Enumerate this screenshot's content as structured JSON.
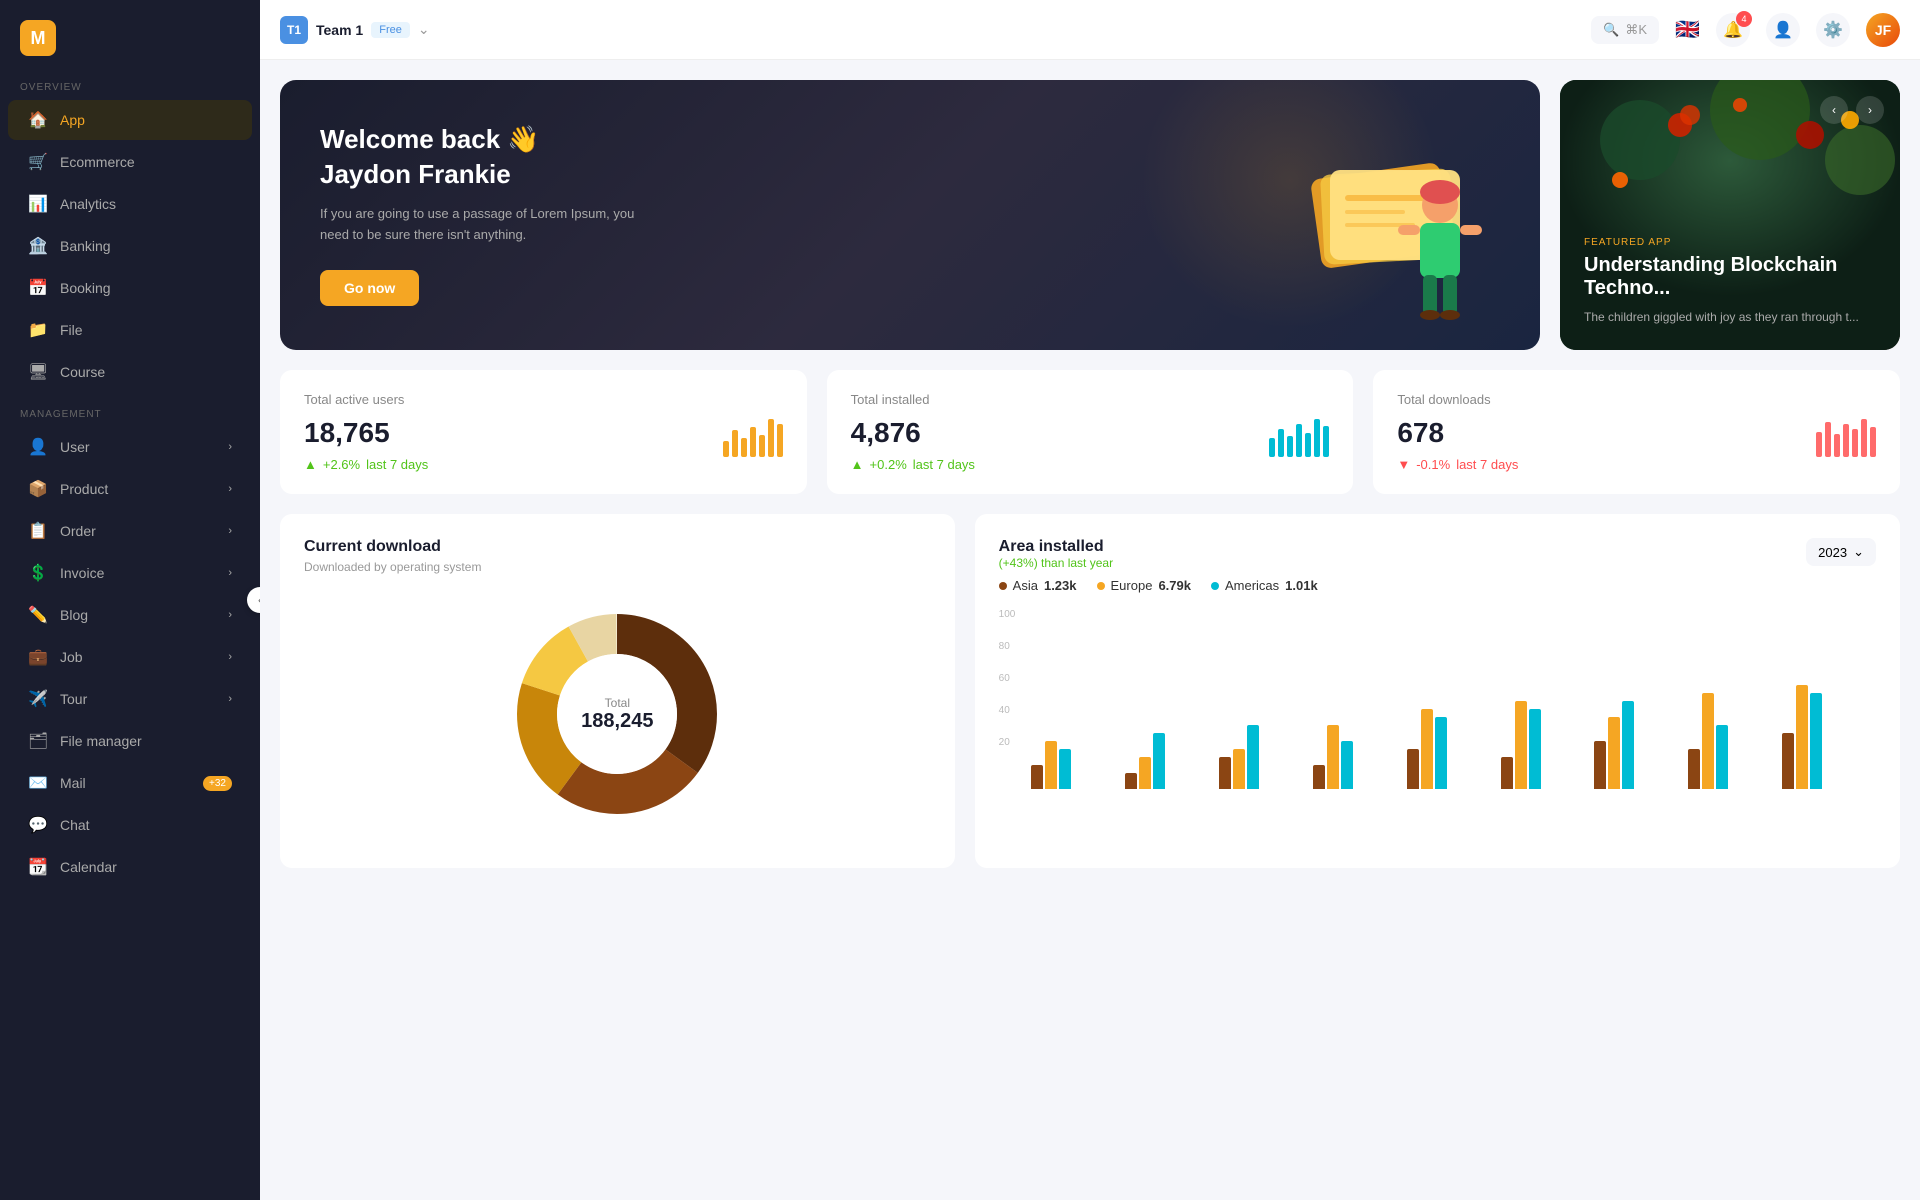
{
  "logo": {
    "text": "M"
  },
  "sidebar": {
    "overview_label": "OVERVIEW",
    "management_label": "MANAGEMENT",
    "items_overview": [
      {
        "id": "app",
        "label": "App",
        "icon": "🏠",
        "active": true
      },
      {
        "id": "ecommerce",
        "label": "Ecommerce",
        "icon": "🛒",
        "active": false
      },
      {
        "id": "analytics",
        "label": "Analytics",
        "icon": "📊",
        "active": false
      },
      {
        "id": "banking",
        "label": "Banking",
        "icon": "🏦",
        "active": false
      },
      {
        "id": "booking",
        "label": "Booking",
        "icon": "📅",
        "active": false
      },
      {
        "id": "file",
        "label": "File",
        "icon": "📁",
        "active": false
      },
      {
        "id": "course",
        "label": "Course",
        "icon": "🖥",
        "active": false
      }
    ],
    "items_management": [
      {
        "id": "user",
        "label": "User",
        "icon": "👤",
        "has_chevron": true
      },
      {
        "id": "product",
        "label": "Product",
        "icon": "📦",
        "has_chevron": true
      },
      {
        "id": "order",
        "label": "Order",
        "icon": "📋",
        "has_chevron": true
      },
      {
        "id": "invoice",
        "label": "Invoice",
        "icon": "💲",
        "has_chevron": true
      },
      {
        "id": "blog",
        "label": "Blog",
        "icon": "✏️",
        "has_chevron": true
      },
      {
        "id": "job",
        "label": "Job",
        "icon": "💼",
        "has_chevron": true
      },
      {
        "id": "tour",
        "label": "Tour",
        "icon": "✈️",
        "has_chevron": true
      },
      {
        "id": "file_manager",
        "label": "File manager",
        "icon": "🗂",
        "has_chevron": false
      },
      {
        "id": "mail",
        "label": "Mail",
        "icon": "✉️",
        "has_chevron": false,
        "badge": "+32"
      },
      {
        "id": "chat",
        "label": "Chat",
        "icon": "💬",
        "has_chevron": false
      },
      {
        "id": "calendar",
        "label": "Calendar",
        "icon": "📆",
        "has_chevron": false
      }
    ]
  },
  "header": {
    "team_name": "Team 1",
    "team_badge": "Free",
    "search_text": "⌘K",
    "notif_count": "4"
  },
  "welcome": {
    "greeting": "Welcome back 👋",
    "name": "Jaydon Frankie",
    "description": "If you are going to use a passage of Lorem Ipsum, you need to be sure there isn't anything.",
    "cta_label": "Go now"
  },
  "featured": {
    "label": "FEATURED APP",
    "title": "Understanding Blockchain Techno...",
    "description": "The children giggled with joy as they ran through t..."
  },
  "stats": [
    {
      "label": "Total active users",
      "value": "18,765",
      "change": "+2.6%",
      "change_label": "last 7 days",
      "trend": "up",
      "bars": [
        30,
        50,
        35,
        55,
        40,
        70,
        60
      ],
      "color": "#f5a623"
    },
    {
      "label": "Total installed",
      "value": "4,876",
      "change": "+0.2%",
      "change_label": "last 7 days",
      "trend": "up",
      "bars": [
        40,
        60,
        45,
        70,
        50,
        80,
        65
      ],
      "color": "#00bcd4"
    },
    {
      "label": "Total downloads",
      "value": "678",
      "change": "-0.1%",
      "change_label": "last 7 days",
      "trend": "down",
      "bars": [
        50,
        70,
        45,
        65,
        55,
        75,
        60
      ],
      "color": "#ff6b6b"
    }
  ],
  "download": {
    "title": "Current download",
    "subtitle": "Downloaded by operating system",
    "total_label": "Total",
    "total_value": "188,245",
    "segments": [
      {
        "color": "#5d2e0c",
        "percent": 35
      },
      {
        "color": "#8b4513",
        "percent": 25
      },
      {
        "color": "#c8860a",
        "percent": 20
      },
      {
        "color": "#f5c842",
        "percent": 12
      },
      {
        "color": "#e8d5a3",
        "percent": 8
      }
    ]
  },
  "area": {
    "title": "Area installed",
    "subtitle": "(+43%) than last year",
    "year": "2023",
    "legend": [
      {
        "label": "Asia",
        "value": "1.23k",
        "color": "#8b4513"
      },
      {
        "label": "Europe",
        "value": "6.79k",
        "color": "#f5a623"
      },
      {
        "label": "Americas",
        "value": "1.01k",
        "color": "#00bcd4"
      }
    ],
    "y_labels": [
      "100",
      "80",
      "60",
      "40",
      "20",
      ""
    ],
    "bars": [
      {
        "asia": 15,
        "europe": 30,
        "americas": 25
      },
      {
        "asia": 10,
        "europe": 20,
        "americas": 35
      },
      {
        "asia": 20,
        "europe": 25,
        "americas": 40
      },
      {
        "asia": 15,
        "europe": 40,
        "americas": 30
      },
      {
        "asia": 25,
        "europe": 50,
        "americas": 45
      },
      {
        "asia": 20,
        "europe": 55,
        "americas": 50
      },
      {
        "asia": 30,
        "europe": 45,
        "americas": 55
      },
      {
        "asia": 25,
        "europe": 60,
        "americas": 40
      },
      {
        "asia": 35,
        "europe": 65,
        "americas": 60
      }
    ]
  }
}
